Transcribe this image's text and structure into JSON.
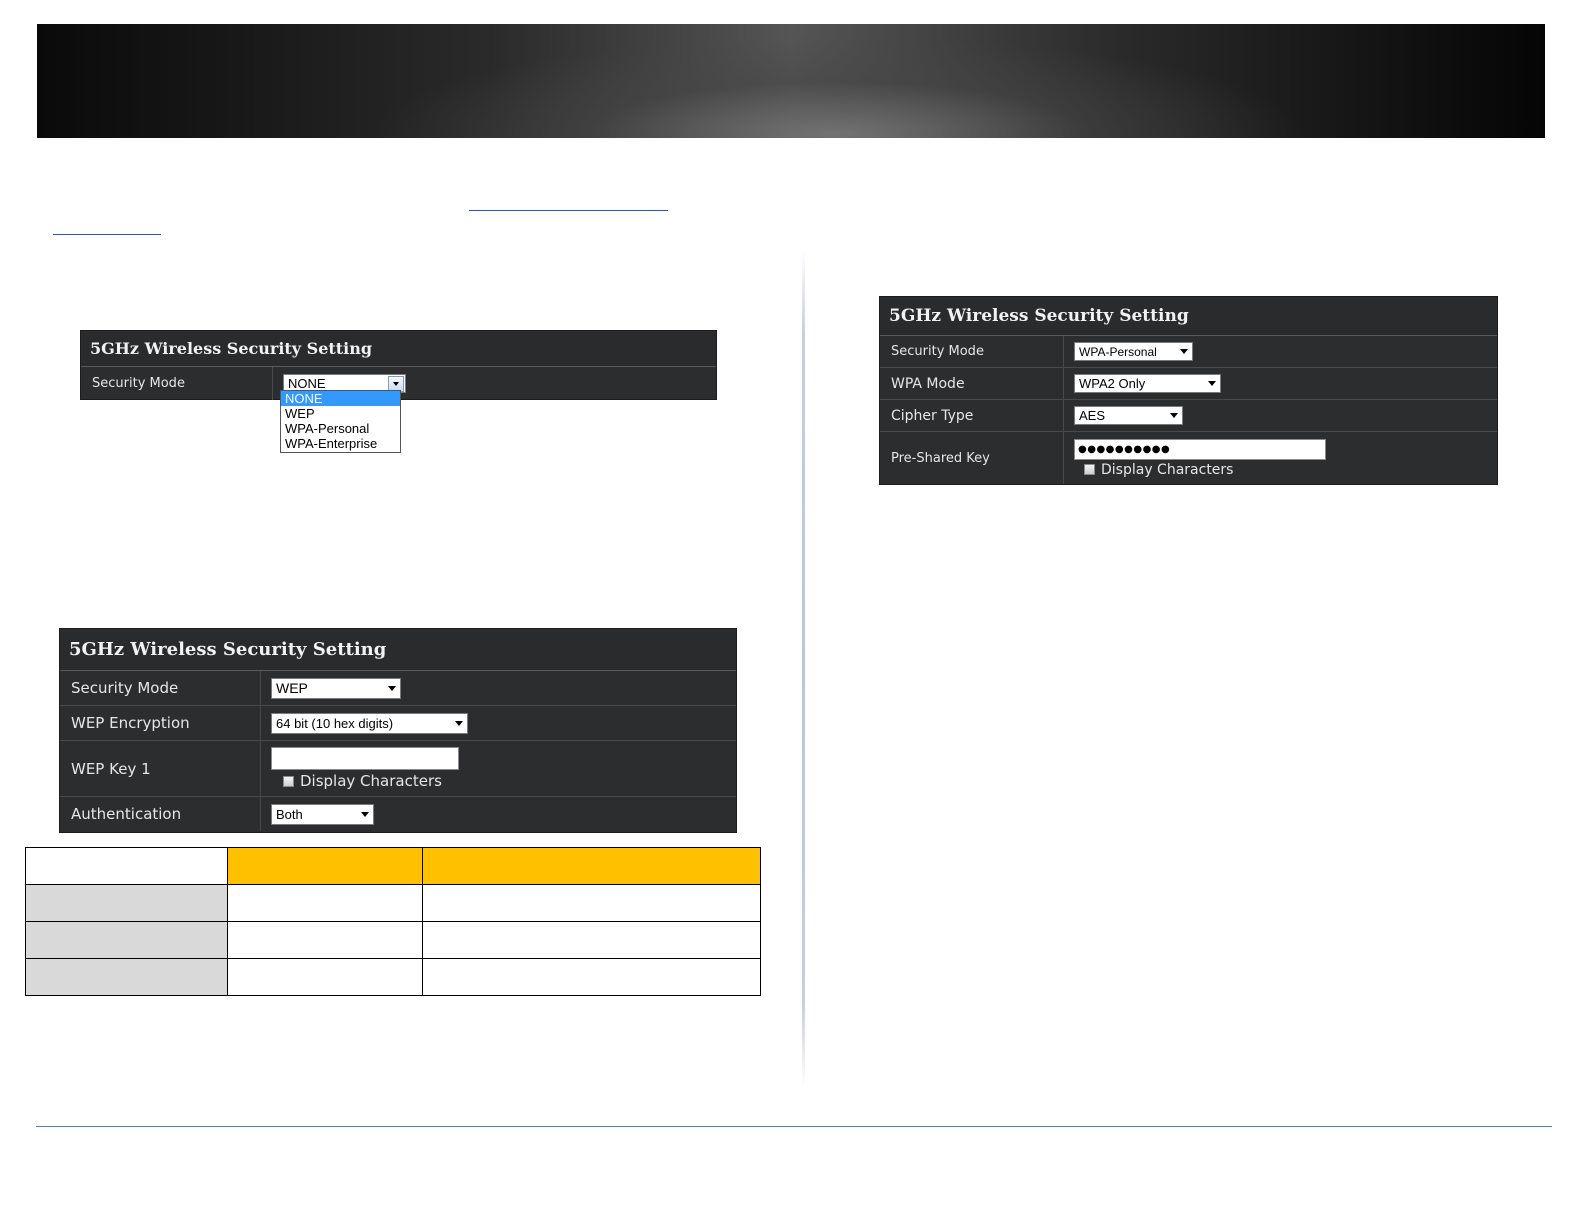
{
  "panel_a": {
    "title": "5GHz Wireless Security Setting",
    "security_mode_label": "Security Mode",
    "security_mode_value": "NONE",
    "options": [
      "NONE",
      "WEP",
      "WPA-Personal",
      "WPA-Enterprise"
    ]
  },
  "panel_b": {
    "title": "5GHz Wireless Security Setting",
    "security_mode_label": "Security Mode",
    "security_mode_value": "WEP",
    "wep_encryption_label": "WEP Encryption",
    "wep_encryption_value": "64 bit (10 hex digits)",
    "wep_key_label": "WEP Key 1",
    "wep_key_value": "",
    "display_characters_label": "Display Characters",
    "authentication_label": "Authentication",
    "authentication_value": "Both"
  },
  "panel_c": {
    "title": "5GHz Wireless Security Setting",
    "security_mode_label": "Security Mode",
    "security_mode_value": "WPA-Personal",
    "wpa_mode_label": "WPA Mode",
    "wpa_mode_value": "WPA2 Only",
    "cipher_type_label": "Cipher Type",
    "cipher_type_value": "AES",
    "psk_label": "Pre-Shared Key",
    "psk_value": "●●●●●●●●●●",
    "display_characters_label": "Display Characters"
  },
  "colors": {
    "table_header_accent": "#ffc000",
    "table_label_fill": "#d9d9d9",
    "panel_background": "#2c2d2f",
    "link_underline": "#2a4fd8",
    "footer_rule": "#4f81bd"
  }
}
